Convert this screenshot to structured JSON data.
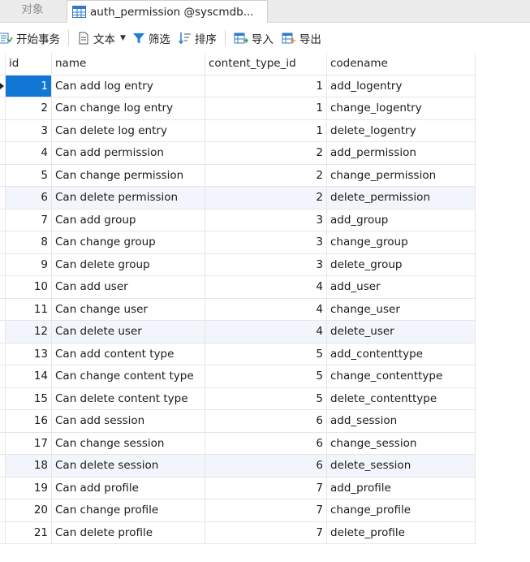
{
  "tabs": {
    "objects_label": "对象",
    "table_tab_label": "auth_permission @syscmdb..."
  },
  "toolbar": {
    "begin_transaction": "开始事务",
    "text": "文本",
    "filter": "筛选",
    "sort": "排序",
    "import": "导入",
    "export": "导出"
  },
  "grid": {
    "columns": [
      "id",
      "name",
      "content_type_id",
      "codename"
    ],
    "rows": [
      {
        "id": "1",
        "name": "Can add log entry",
        "content_type_id": "1",
        "codename": "add_logentry"
      },
      {
        "id": "2",
        "name": "Can change log entry",
        "content_type_id": "1",
        "codename": "change_logentry"
      },
      {
        "id": "3",
        "name": "Can delete log entry",
        "content_type_id": "1",
        "codename": "delete_logentry"
      },
      {
        "id": "4",
        "name": "Can add permission",
        "content_type_id": "2",
        "codename": "add_permission"
      },
      {
        "id": "5",
        "name": "Can change permission",
        "content_type_id": "2",
        "codename": "change_permission"
      },
      {
        "id": "6",
        "name": "Can delete permission",
        "content_type_id": "2",
        "codename": "delete_permission"
      },
      {
        "id": "7",
        "name": "Can add group",
        "content_type_id": "3",
        "codename": "add_group"
      },
      {
        "id": "8",
        "name": "Can change group",
        "content_type_id": "3",
        "codename": "change_group"
      },
      {
        "id": "9",
        "name": "Can delete group",
        "content_type_id": "3",
        "codename": "delete_group"
      },
      {
        "id": "10",
        "name": "Can add user",
        "content_type_id": "4",
        "codename": "add_user"
      },
      {
        "id": "11",
        "name": "Can change user",
        "content_type_id": "4",
        "codename": "change_user"
      },
      {
        "id": "12",
        "name": "Can delete user",
        "content_type_id": "4",
        "codename": "delete_user"
      },
      {
        "id": "13",
        "name": "Can add content type",
        "content_type_id": "5",
        "codename": "add_contenttype"
      },
      {
        "id": "14",
        "name": "Can change content type",
        "content_type_id": "5",
        "codename": "change_contenttype"
      },
      {
        "id": "15",
        "name": "Can delete content type",
        "content_type_id": "5",
        "codename": "delete_contenttype"
      },
      {
        "id": "16",
        "name": "Can add session",
        "content_type_id": "6",
        "codename": "add_session"
      },
      {
        "id": "17",
        "name": "Can change session",
        "content_type_id": "6",
        "codename": "change_session"
      },
      {
        "id": "18",
        "name": "Can delete session",
        "content_type_id": "6",
        "codename": "delete_session"
      },
      {
        "id": "19",
        "name": "Can add profile",
        "content_type_id": "7",
        "codename": "add_profile"
      },
      {
        "id": "20",
        "name": "Can change profile",
        "content_type_id": "7",
        "codename": "change_profile"
      },
      {
        "id": "21",
        "name": "Can delete profile",
        "content_type_id": "7",
        "codename": "delete_profile"
      }
    ]
  },
  "colors": {
    "selection": "#1176d4",
    "alt_row": "#f2f6fc",
    "filter_icon": "#1a7fd8"
  }
}
